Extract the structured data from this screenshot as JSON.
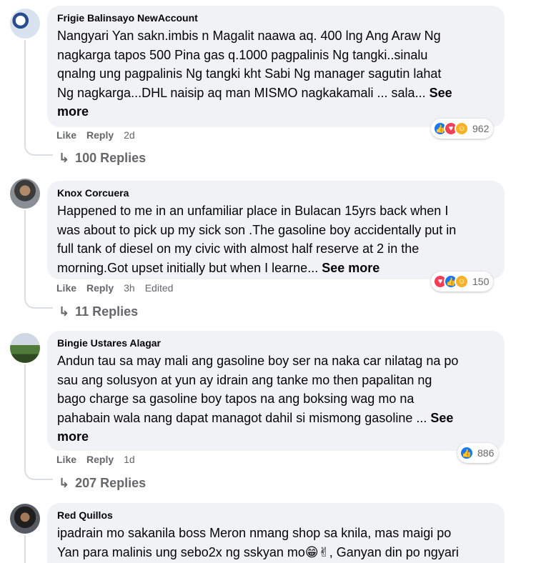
{
  "comments": [
    {
      "author": "Frigie Balinsayo NewAccount",
      "text": "Nangyari Yan sakn.imbis n Magalit naawa aq. 400 lng Ang Araw Ng\nnagkarga tapos 500 Pina gas q.1000 pagpalinis Ng tangki..sinalu\nqnalng ung pagpalinis Ng tangki kht Sabi Ng manager sagutin lahat\nNg nagkarga...DHL naisip aq man MISMO nagkakamali ... sala... ",
      "see_more": "See\nmore",
      "like": "Like",
      "reply": "Reply",
      "time": "2d",
      "edited": "",
      "reaction_count": "962",
      "reactions": [
        "like-icon",
        "love-icon",
        "care-icon"
      ],
      "replies": "100 Replies"
    },
    {
      "author": "Knox Corcuera",
      "text": "Happened to me in an unfamiliar place in Bulacan 15yrs back when I\nwas about to pick up my sick son .The gasoline boy accidentally put in\nfull tank of diesel on my civic with almost half reserve at 2 in the\nmorning.Got upset initially but when I learne... ",
      "see_more": "See more",
      "like": "Like",
      "reply": "Reply",
      "time": "3h",
      "edited": "Edited",
      "reaction_count": "150",
      "reactions": [
        "love-icon",
        "like-icon",
        "care-icon"
      ],
      "replies": "11 Replies"
    },
    {
      "author": "Bingie Ustares Alagar",
      "text": "Andun tau sa may mali ang gasoline boy ser na naka car nilatag na po\nsau ang solusyon at yun ay idrain ang tanke mo then papalitan ng\nbago charge sa gasoline boy tapos na ang boksing wag mo na\npahabain wala nang dapat managot dahil si mismong gasoline ... ",
      "see_more": "See\nmore",
      "like": "Like",
      "reply": "Reply",
      "time": "1d",
      "edited": "",
      "reaction_count": "886",
      "reactions": [
        "like-icon"
      ],
      "replies": "207 Replies"
    },
    {
      "author": "Red Quillos",
      "text": "ipadrain mo sakanila boss Meron nmang shop sa knila, mas maigi po\nYan para malinis ung sebo2x ng sskyan mo😁✌, Ganyan din po ngyari",
      "see_more": "",
      "like": "",
      "reply": "",
      "time": "",
      "edited": "",
      "reaction_count": "",
      "reactions": [],
      "replies": ""
    }
  ],
  "colors": {
    "bubble": "#f0f2f5",
    "meta": "#65676b",
    "like": "#1877f2",
    "love": "#f33e58",
    "care": "#f7b125"
  }
}
